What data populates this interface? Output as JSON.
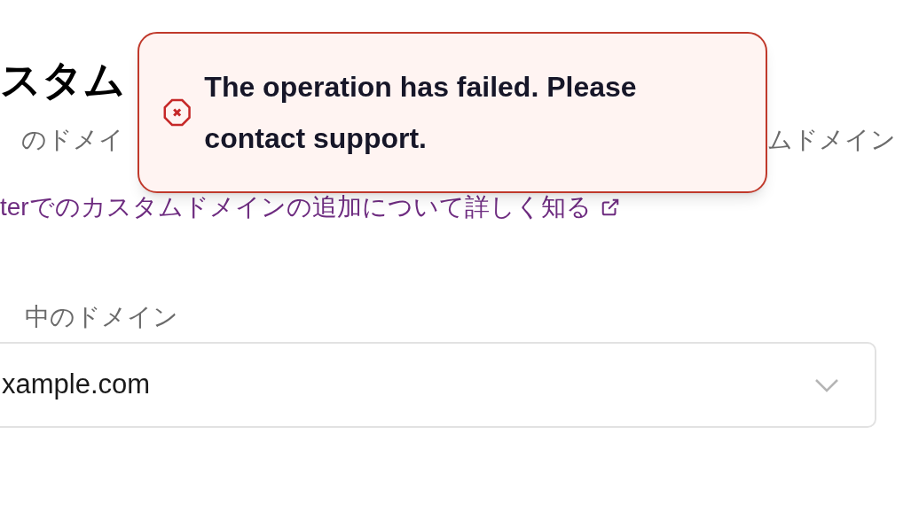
{
  "page": {
    "heading": "スタム",
    "description_left": "のドメイ",
    "description_right": "ムドメイン",
    "learn_more_link": "terでのカスタムドメインの追加について詳しく知る"
  },
  "domain_select": {
    "label": "中のドメイン",
    "value": "xample.com"
  },
  "toast": {
    "kind": "error",
    "message": "The operation has failed. Please contact support."
  }
}
